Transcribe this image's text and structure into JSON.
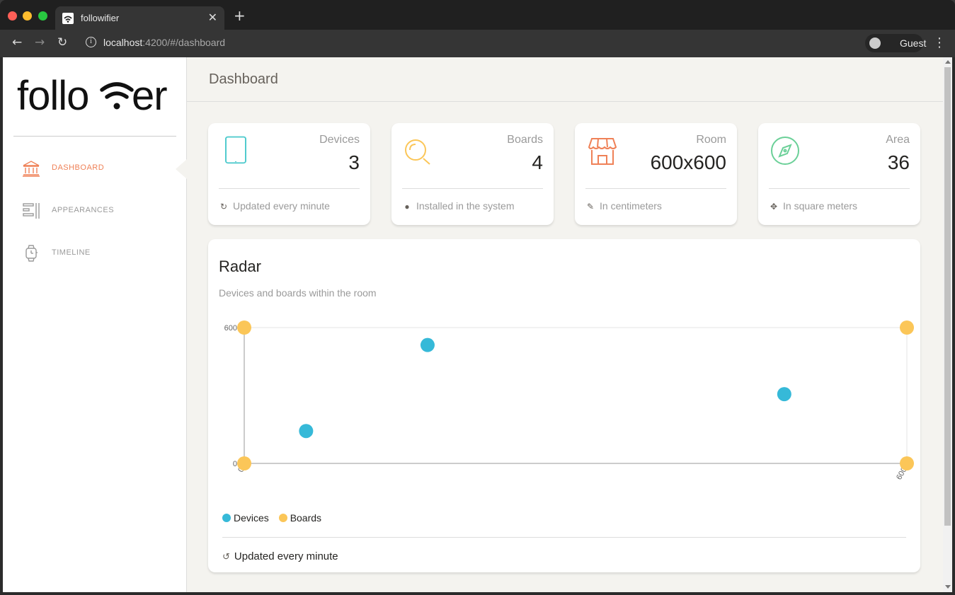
{
  "browser": {
    "tab_title": "followifier",
    "url_host": "localhost",
    "url_path": ":4200/#/dashboard",
    "profile_label": "Guest"
  },
  "sidebar": {
    "logo_text": "follower",
    "items": [
      {
        "label": "DASHBOARD",
        "icon": "bank-icon",
        "active": true
      },
      {
        "label": "APPEARANCES",
        "icon": "align-left-icon",
        "active": false
      },
      {
        "label": "TIMELINE",
        "icon": "watch-icon",
        "active": false
      }
    ]
  },
  "header": {
    "title": "Dashboard"
  },
  "stats": [
    {
      "label": "Devices",
      "value": "3",
      "footer": "Updated every minute",
      "icon": "mobile-icon",
      "footer_icon": "refresh-icon",
      "color": "#51cbce"
    },
    {
      "label": "Boards",
      "value": "4",
      "footer": "Installed in the system",
      "icon": "zoom-icon",
      "footer_icon": "user-icon",
      "color": "#fbc658"
    },
    {
      "label": "Room",
      "value": "600x600",
      "footer": "In centimeters",
      "icon": "shop-icon",
      "footer_icon": "pencil-icon",
      "color": "#ef8157"
    },
    {
      "label": "Area",
      "value": "36",
      "footer": "In square meters",
      "icon": "compass-icon",
      "footer_icon": "move-icon",
      "color": "#6bd098"
    }
  ],
  "radar": {
    "title": "Radar",
    "subtitle": "Devices and boards within the room",
    "footer": "Updated every minute",
    "footer_icon": "history-icon"
  },
  "chart_data": {
    "type": "scatter",
    "title": "",
    "xlabel": "",
    "ylabel": "",
    "xlim": [
      0,
      600
    ],
    "ylim": [
      0,
      600
    ],
    "x_ticks": [
      "0",
      "600"
    ],
    "y_ticks": [
      "0",
      "600"
    ],
    "legend": "bottom-left",
    "series": [
      {
        "name": "Devices",
        "color": "#36b9d8",
        "points": [
          [
            56,
            143
          ],
          [
            166,
            523
          ],
          [
            489,
            306
          ]
        ]
      },
      {
        "name": "Boards",
        "color": "#fbc658",
        "points": [
          [
            0,
            0
          ],
          [
            0,
            600
          ],
          [
            600,
            600
          ],
          [
            600,
            0
          ]
        ]
      }
    ]
  }
}
